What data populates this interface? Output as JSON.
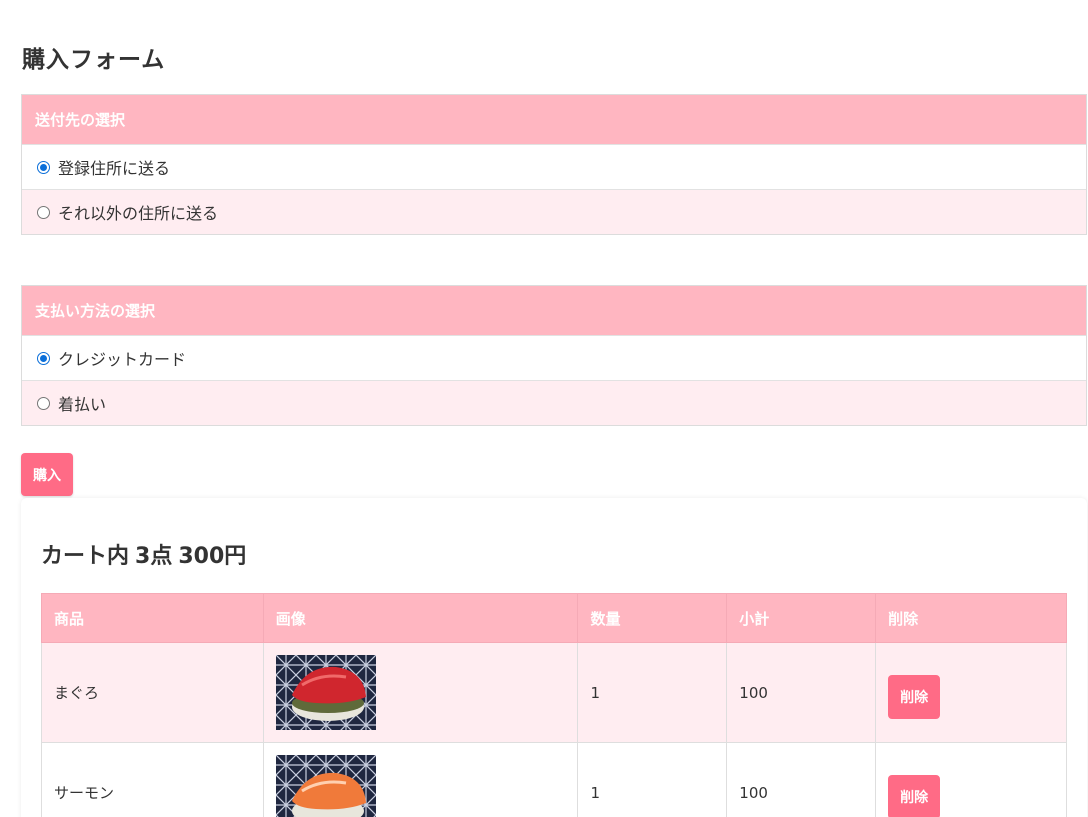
{
  "page": {
    "title": "購入フォーム"
  },
  "shipping": {
    "heading": "送付先の選択",
    "options": [
      {
        "label": "登録住所に送る",
        "checked": true
      },
      {
        "label": "それ以外の住所に送る",
        "checked": false
      }
    ]
  },
  "payment": {
    "heading": "支払い方法の選択",
    "options": [
      {
        "label": "クレジットカード",
        "checked": true
      },
      {
        "label": "着払い",
        "checked": false
      }
    ]
  },
  "buy_button": {
    "label": "購入"
  },
  "cart": {
    "title_prefix": "カート内",
    "count": "3点",
    "total": "300円",
    "columns": [
      "商品",
      "画像",
      "数量",
      "小計",
      "削除"
    ],
    "rows": [
      {
        "name": "まぐろ",
        "image": "maguro-sushi",
        "quantity": "1",
        "subtotal": "100",
        "delete_label": "削除"
      },
      {
        "name": "サーモン",
        "image": "salmon-sushi",
        "quantity": "1",
        "subtotal": "100",
        "delete_label": "削除"
      }
    ]
  },
  "colors": {
    "header_pink": "#ffb6c1",
    "row_pink": "#ffedf1",
    "button_pink": "#ff6b86",
    "radio_blue": "#0b6fd9"
  }
}
